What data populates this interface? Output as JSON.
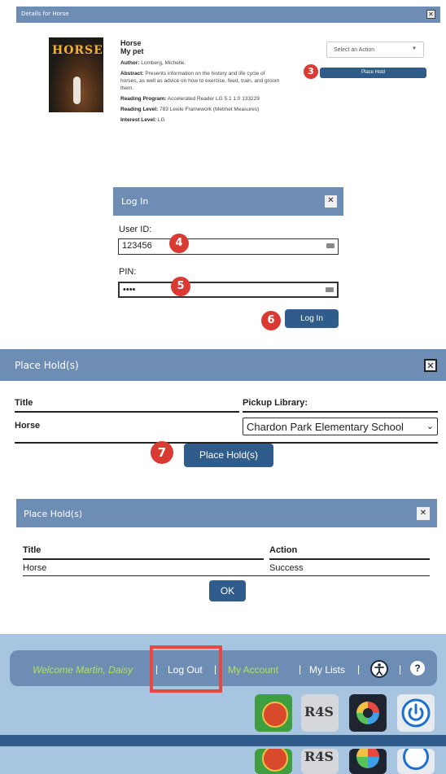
{
  "details": {
    "window_title": "Details for Horse",
    "cover_text": "HORSE",
    "book_title": "Horse",
    "subtitle": "My pet",
    "author_label": "Author:",
    "author": "Lomberg, Michelle.",
    "abstract_label": "Abstract:",
    "abstract": "Presents information on the history and life cycle of horses, as well as advice on how to exercise, feed, train, and groom them.",
    "reading_program_label": "Reading Program:",
    "reading_program": "Accelerated Reader LG 5.1 1.0 133229",
    "reading_level_label": "Reading Level:",
    "reading_level": "783 Lexile Framework (Metmet Measures)",
    "interest_level_label": "Interest Level:",
    "interest_level": "LG",
    "action_select": "Select an Action",
    "place_hold_button": "Place Hold",
    "step": "3"
  },
  "login": {
    "title": "Log In",
    "user_id_label": "User ID:",
    "user_id_value": "123456",
    "pin_label": "PIN:",
    "pin_value": "••••",
    "login_button": "Log In",
    "step_user": "4",
    "step_pin": "5",
    "step_login": "6"
  },
  "place_holds": {
    "title": "Place Hold(s)",
    "col_title": "Title",
    "col_pickup": "Pickup Library:",
    "row_title": "Horse",
    "pickup_value": "Chardon Park Elementary School",
    "button": "Place Hold(s)",
    "step": "7"
  },
  "result": {
    "title": "Place Hold(s)",
    "col_title": "Title",
    "col_action": "Action",
    "row_title": "Horse",
    "row_action": "Success",
    "ok_button": "OK"
  },
  "navbar": {
    "welcome": "Welcome Martin, Daisy",
    "logout": "Log Out",
    "my_account": "My Account",
    "my_lists": "My Lists",
    "sep": "|",
    "help": "?",
    "app_tile_2": "R4S",
    "colors": {
      "bar": "#6d8db4",
      "welcome": "#b5e05a",
      "my_account": "#b5e05a",
      "logout_highlight": "#e8473f"
    }
  }
}
